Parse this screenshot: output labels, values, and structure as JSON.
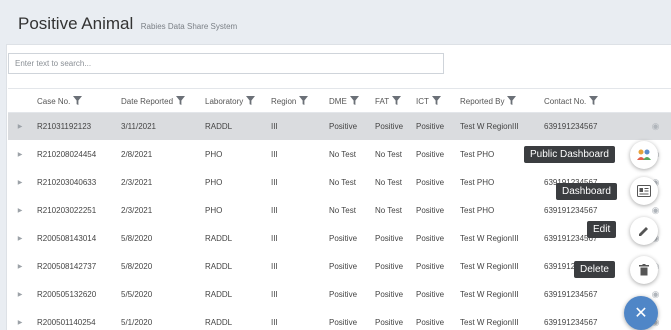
{
  "header": {
    "title": "Positive Animal",
    "subtitle": "Rabies Data Share System"
  },
  "search": {
    "placeholder": "Enter text to search..."
  },
  "table": {
    "columns": [
      "Case No.",
      "Date Reported",
      "Laboratory",
      "Region",
      "DME",
      "FAT",
      "ICT",
      "Reported By",
      "Contact No."
    ],
    "rows": [
      [
        "R21031192123",
        "3/11/2021",
        "RADDL",
        "III",
        "Positive",
        "Positive",
        "Positive",
        "Test W RegionIII",
        "639191234567"
      ],
      [
        "R210208024454",
        "2/8/2021",
        "PHO",
        "III",
        "No Test",
        "No Test",
        "Positive",
        "Test PHO",
        "639191234567"
      ],
      [
        "R210203040633",
        "2/3/2021",
        "PHO",
        "III",
        "No Test",
        "No Test",
        "Positive",
        "Test PHO",
        "639191234567"
      ],
      [
        "R210203022251",
        "2/3/2021",
        "PHO",
        "III",
        "No Test",
        "No Test",
        "Positive",
        "Test PHO",
        "639191234567"
      ],
      [
        "R200508143014",
        "5/8/2020",
        "RADDL",
        "III",
        "Positive",
        "Positive",
        "Positive",
        "Test W RegionIII",
        "639191234567"
      ],
      [
        "R200508142737",
        "5/8/2020",
        "RADDL",
        "III",
        "Positive",
        "Positive",
        "Positive",
        "Test W RegionIII",
        "639191234567"
      ],
      [
        "R200505132620",
        "5/5/2020",
        "RADDL",
        "III",
        "Positive",
        "Positive",
        "Positive",
        "Test W RegionIII",
        "639191234567"
      ],
      [
        "R200501140254",
        "5/1/2020",
        "RADDL",
        "III",
        "Positive",
        "Positive",
        "Positive",
        "Test W RegionIII",
        "639191234567"
      ]
    ]
  },
  "fab_menu": {
    "public_dashboard_label": "Public Dashboard",
    "dashboard_label": "Dashboard",
    "edit_label": "Edit",
    "delete_label": "Delete"
  },
  "colors": {
    "fab_main": "#4f86c7",
    "selected_row": "#dadcdf",
    "tooltip_bg": "#3b3d40"
  }
}
